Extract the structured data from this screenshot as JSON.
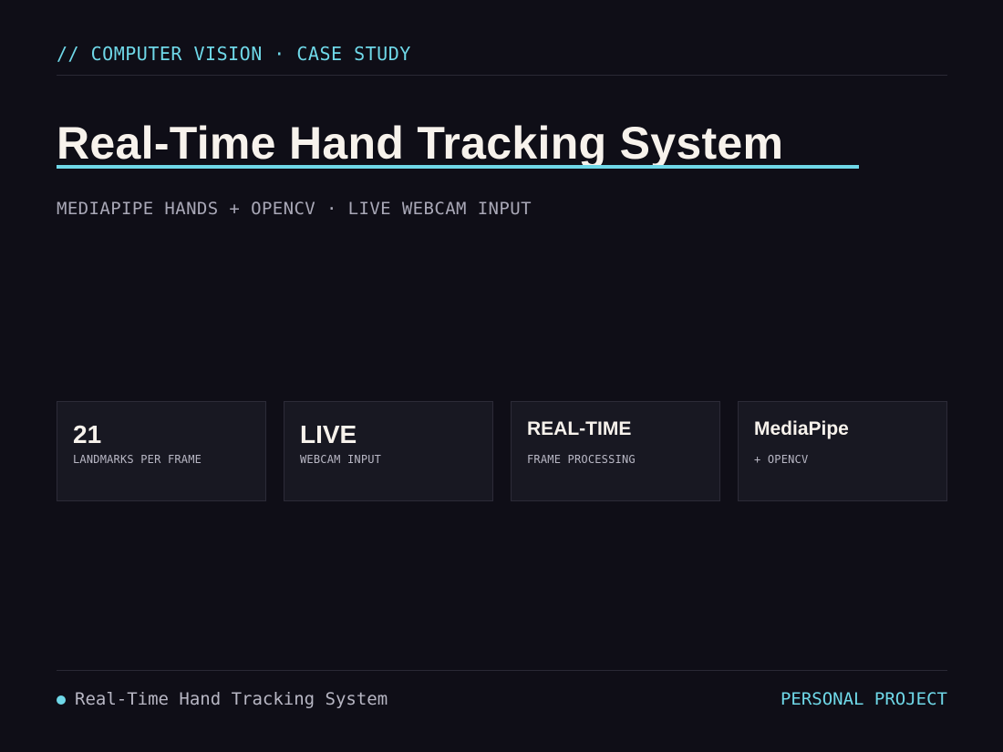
{
  "header": {
    "kicker": "// COMPUTER VISION · CASE STUDY"
  },
  "hero": {
    "title": "Real-Time Hand Tracking System",
    "subtitle": "MEDIAPIPE HANDS + OPENCV · LIVE WEBCAM INPUT"
  },
  "stats": [
    {
      "value": "21",
      "label": "LANDMARKS PER FRAME"
    },
    {
      "value": "LIVE",
      "label": "WEBCAM INPUT"
    },
    {
      "value": "REAL-TIME",
      "label": "FRAME PROCESSING"
    },
    {
      "value": "MediaPipe",
      "label": "+ OPENCV"
    }
  ],
  "footer": {
    "title": "Real-Time Hand Tracking System",
    "tag": "PERSONAL PROJECT"
  },
  "colors": {
    "background": "#0f0e17",
    "accent": "#6fd8e8",
    "text_primary": "#f7f2ec",
    "text_muted": "#a9a8b7",
    "card_background": "#181822"
  }
}
